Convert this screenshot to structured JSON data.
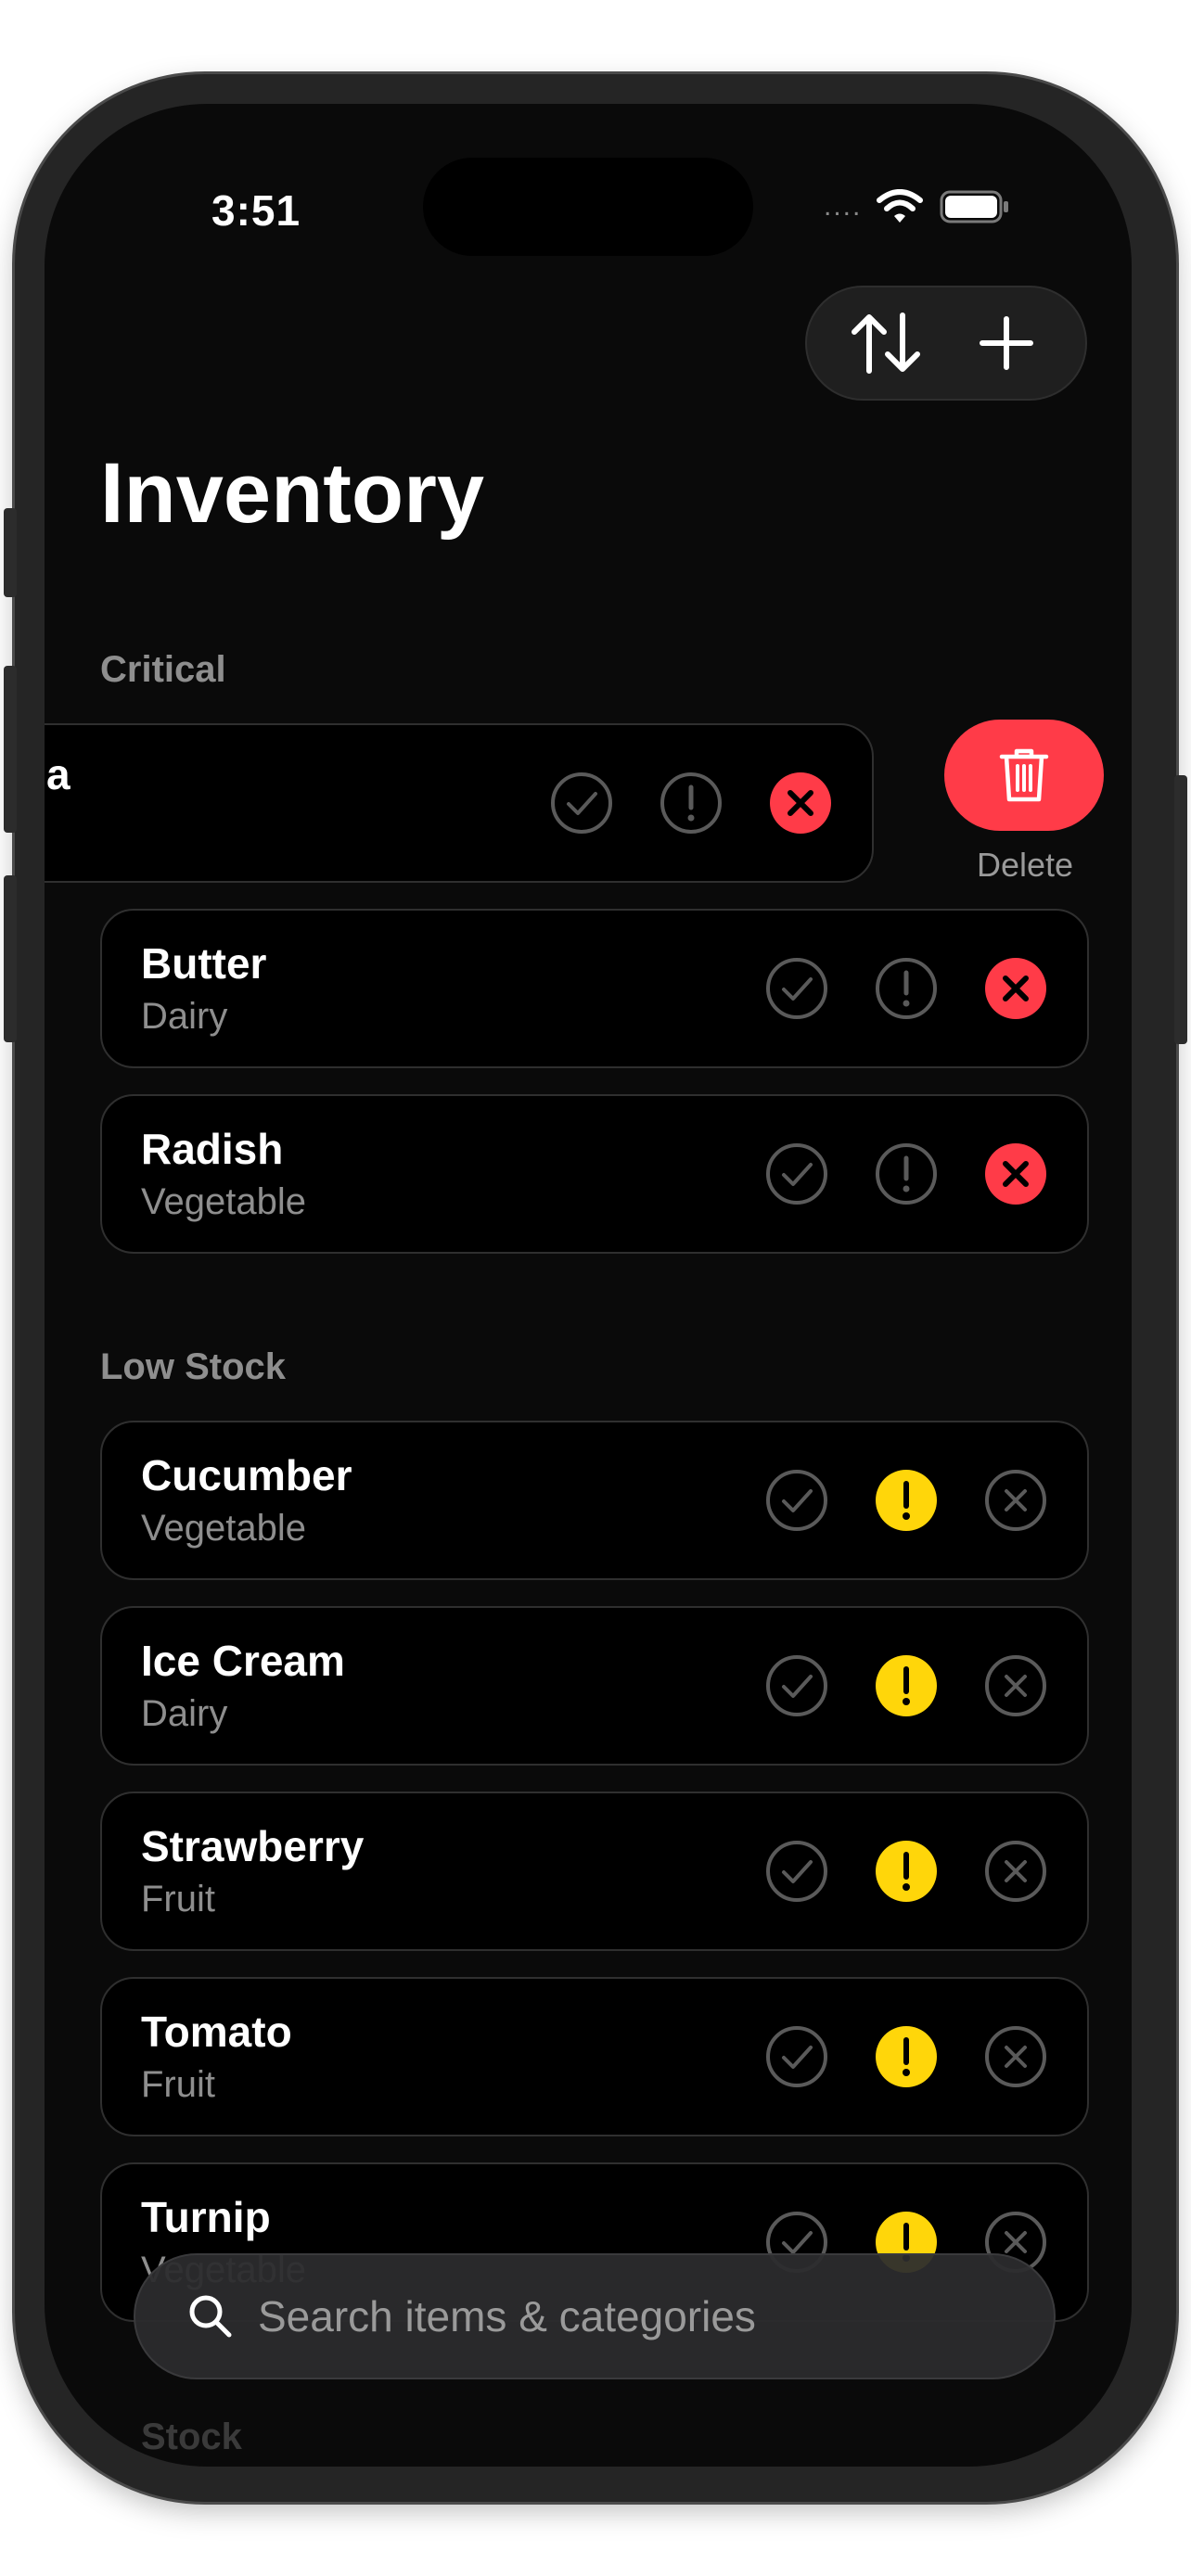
{
  "status_bar": {
    "time": "3:51",
    "signal": "...."
  },
  "toolbar": {
    "sort_icon": "sort-arrows-icon",
    "add_icon": "plus-icon"
  },
  "page": {
    "title": "Inventory"
  },
  "sections": {
    "critical": {
      "header": "Critical"
    },
    "low_stock": {
      "header": "Low Stock"
    },
    "in_stock_partial": "Stock"
  },
  "swiped_row": {
    "name_fragment": "a",
    "delete_label": "Delete"
  },
  "rows": {
    "butter": {
      "name": "Butter",
      "category": "Dairy",
      "status": "critical"
    },
    "radish": {
      "name": "Radish",
      "category": "Vegetable",
      "status": "critical"
    },
    "cucumber": {
      "name": "Cucumber",
      "category": "Vegetable",
      "status": "low"
    },
    "ice_cream": {
      "name": "Ice Cream",
      "category": "Dairy",
      "status": "low"
    },
    "strawberry": {
      "name": "Strawberry",
      "category": "Fruit",
      "status": "low"
    },
    "tomato": {
      "name": "Tomato",
      "category": "Fruit",
      "status": "low"
    },
    "turnip": {
      "name": "Turnip",
      "category": "Vegetable",
      "status": "low"
    }
  },
  "search": {
    "placeholder": "Search items & categories"
  },
  "colors": {
    "critical": "#ff3b48",
    "low": "#ffd60a",
    "outline": "#5a5a5a"
  }
}
